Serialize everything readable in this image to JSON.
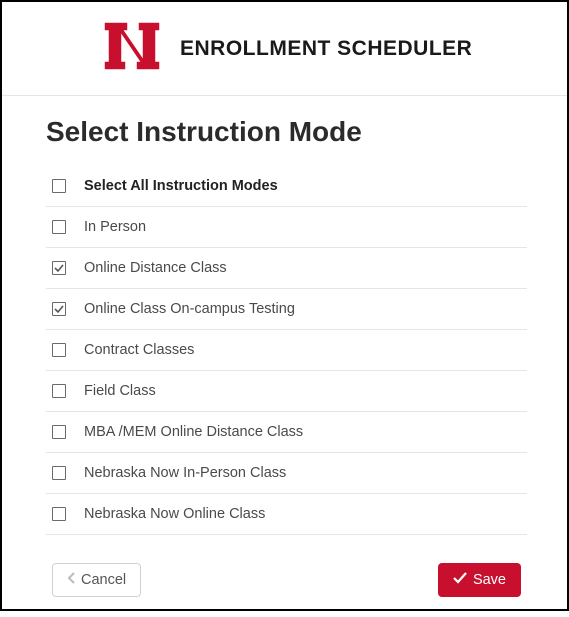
{
  "header": {
    "app_title": "ENROLLMENT SCHEDULER"
  },
  "page": {
    "title": "Select Instruction Mode"
  },
  "list": {
    "select_all_label": "Select All Instruction Modes",
    "items": [
      {
        "label": "In Person",
        "checked": false
      },
      {
        "label": "Online Distance Class",
        "checked": true
      },
      {
        "label": "Online Class On-campus Testing",
        "checked": true
      },
      {
        "label": "Contract Classes",
        "checked": false
      },
      {
        "label": "Field Class",
        "checked": false
      },
      {
        "label": "MBA /MEM Online Distance Class",
        "checked": false
      },
      {
        "label": "Nebraska Now In-Person Class",
        "checked": false
      },
      {
        "label": "Nebraska Now Online Class",
        "checked": false
      }
    ]
  },
  "footer": {
    "cancel_label": "Cancel",
    "save_label": "Save"
  },
  "colors": {
    "brand_red": "#c8102e"
  }
}
